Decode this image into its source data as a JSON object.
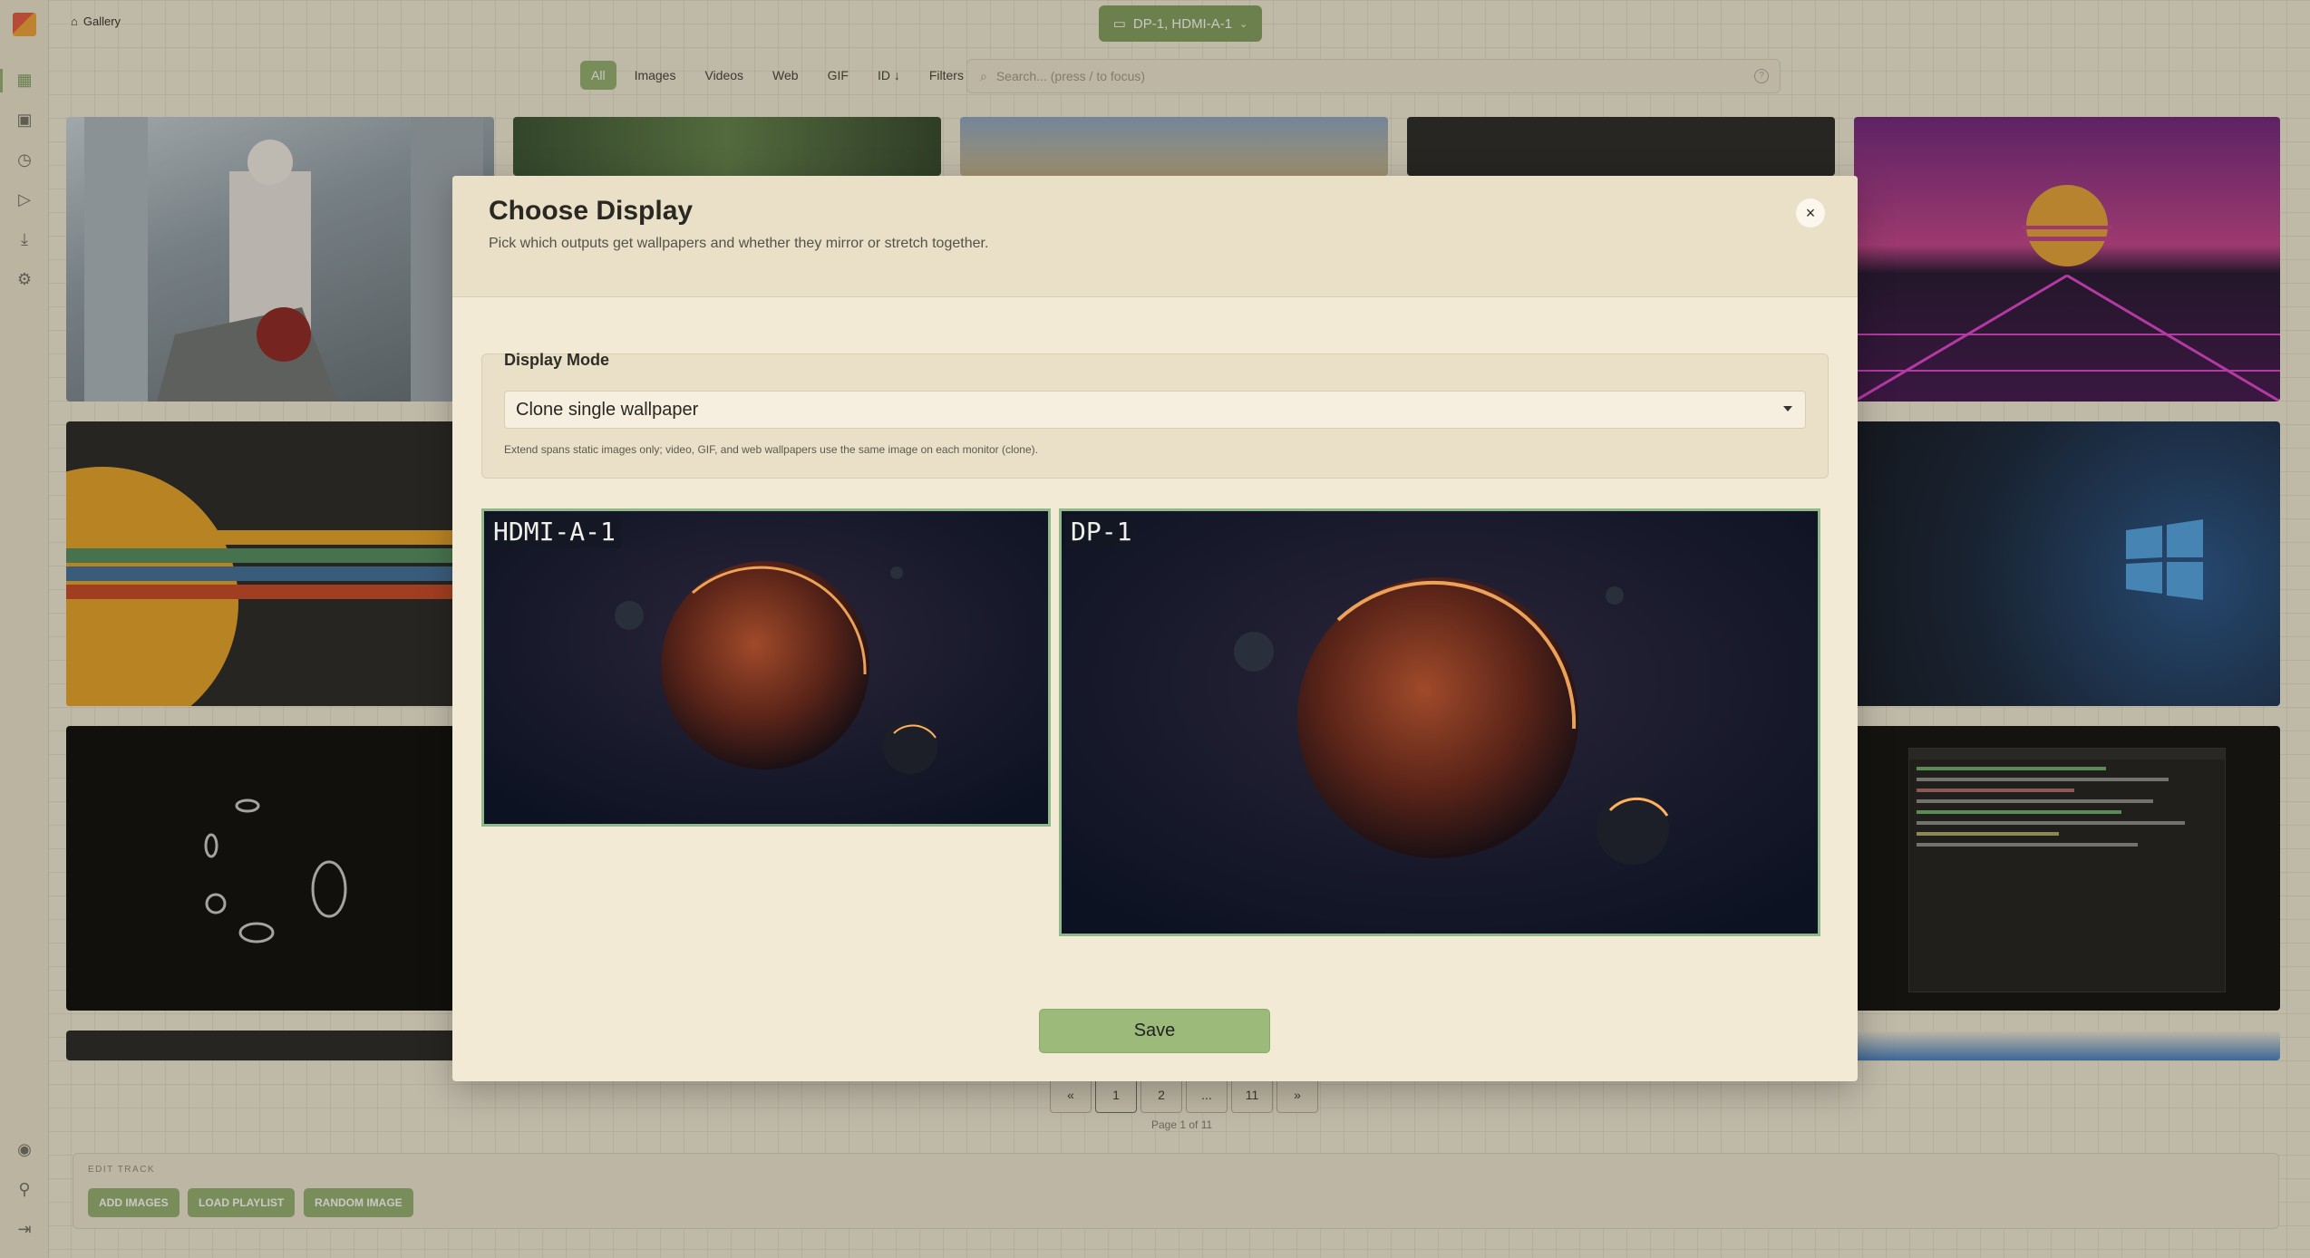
{
  "app": {
    "breadcrumb": "Gallery",
    "display_selector": "DP-1, HDMI-A-1",
    "tabs": [
      "All",
      "Images",
      "Videos",
      "Web",
      "GIF",
      "ID ↓",
      "Filters"
    ],
    "active_tab": "All",
    "search_placeholder": "Search... (press / to focus)",
    "pagination": {
      "prev": "«",
      "pages": [
        "1",
        "2",
        "...",
        "11"
      ],
      "next": "»",
      "info": "Page 1 of 11"
    },
    "edit_track": {
      "label": "EDIT TRACK",
      "buttons": [
        "ADD IMAGES",
        "LOAD PLAYLIST",
        "RANDOM IMAGE"
      ]
    }
  },
  "modal": {
    "title": "Choose Display",
    "subtitle": "Pick which outputs get wallpapers and whether they mirror or stretch together.",
    "close_icon": "×",
    "display_mode": {
      "label": "Display Mode",
      "selected": "Clone single wallpaper",
      "note": "Extend spans static images only; video, GIF, and web wallpapers use the same image on each monitor (clone)."
    },
    "monitors": [
      {
        "name": "HDMI-A-1"
      },
      {
        "name": "DP-1"
      }
    ],
    "save_label": "Save"
  },
  "colors": {
    "accent": "#8fae6c",
    "monitor_border": "#8fb98b",
    "modal_bg": "#f3ead6"
  }
}
